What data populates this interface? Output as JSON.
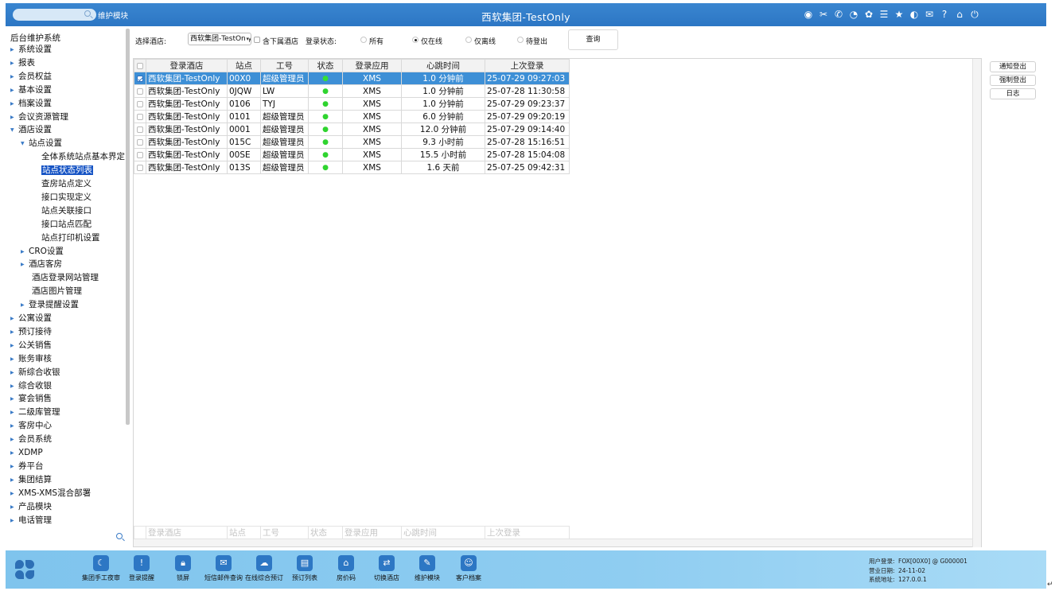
{
  "header": {
    "module_label": "维护模块",
    "title": "西软集团-TestOnly",
    "icons": [
      "wifi-icon",
      "tools-icon",
      "phone-icon",
      "help-circle-icon",
      "palette-icon",
      "menu-icon",
      "star-icon",
      "theme-icon",
      "mail-icon",
      "question-icon",
      "home-icon",
      "power-icon"
    ]
  },
  "sidebar": {
    "root": "后台维护系统",
    "nodes": [
      {
        "label": "系统设置",
        "level": 0,
        "arrow": "closed"
      },
      {
        "label": "报表",
        "level": 0,
        "arrow": "closed"
      },
      {
        "label": "会员权益",
        "level": 0,
        "arrow": "closed"
      },
      {
        "label": "基本设置",
        "level": 0,
        "arrow": "closed"
      },
      {
        "label": "档案设置",
        "level": 0,
        "arrow": "closed"
      },
      {
        "label": "会议资源管理",
        "level": 0,
        "arrow": "closed"
      },
      {
        "label": "酒店设置",
        "level": 0,
        "arrow": "open"
      },
      {
        "label": "站点设置",
        "level": 1,
        "arrow": "open"
      },
      {
        "label": "全体系统站点基本界定",
        "level": 2,
        "arrow": "none"
      },
      {
        "label": "站点状态列表",
        "level": 2,
        "arrow": "none",
        "selected": true
      },
      {
        "label": "查房站点定义",
        "level": 2,
        "arrow": "none"
      },
      {
        "label": "接口实现定义",
        "level": 2,
        "arrow": "none"
      },
      {
        "label": "站点关联接口",
        "level": 2,
        "arrow": "none"
      },
      {
        "label": "接口站点匹配",
        "level": 2,
        "arrow": "none"
      },
      {
        "label": "站点打印机设置",
        "level": 2,
        "arrow": "none"
      },
      {
        "label": "CRO设置",
        "level": 1,
        "arrow": "closed"
      },
      {
        "label": "酒店客房",
        "level": 1,
        "arrow": "closed"
      },
      {
        "label": "酒店登录网站管理",
        "level": 1,
        "arrow": "none"
      },
      {
        "label": "酒店图片管理",
        "level": 1,
        "arrow": "none"
      },
      {
        "label": "登录提醒设置",
        "level": 1,
        "arrow": "closed"
      },
      {
        "label": "公寓设置",
        "level": 0,
        "arrow": "closed"
      },
      {
        "label": "预订接待",
        "level": 0,
        "arrow": "closed"
      },
      {
        "label": "公关销售",
        "level": 0,
        "arrow": "closed"
      },
      {
        "label": "账务审核",
        "level": 0,
        "arrow": "closed"
      },
      {
        "label": "新综合收银",
        "level": 0,
        "arrow": "closed"
      },
      {
        "label": "综合收银",
        "level": 0,
        "arrow": "closed"
      },
      {
        "label": "宴会销售",
        "level": 0,
        "arrow": "closed"
      },
      {
        "label": "二级库管理",
        "level": 0,
        "arrow": "closed"
      },
      {
        "label": "客房中心",
        "level": 0,
        "arrow": "closed"
      },
      {
        "label": "会员系统",
        "level": 0,
        "arrow": "closed"
      },
      {
        "label": "XDMP",
        "level": 0,
        "arrow": "closed"
      },
      {
        "label": "券平台",
        "level": 0,
        "arrow": "closed"
      },
      {
        "label": "集团结算",
        "level": 0,
        "arrow": "closed"
      },
      {
        "label": "XMS-XMS混合部署",
        "level": 0,
        "arrow": "closed"
      },
      {
        "label": "产品模块",
        "level": 0,
        "arrow": "closed"
      },
      {
        "label": "电话管理",
        "level": 0,
        "arrow": "closed"
      }
    ]
  },
  "filter": {
    "hotel_label": "选择酒店:",
    "hotel_value": "西软集团-TestOnly",
    "include_sub_label": "含下属酒店",
    "status_label": "登录状态:",
    "radio_all": "所有",
    "radio_online": "仅在线",
    "radio_offline": "仅离线",
    "radio_pending": "待登出",
    "query_button": "查询"
  },
  "grid": {
    "columns": [
      "登录酒店",
      "站点",
      "工号",
      "状态",
      "登录应用",
      "心跳时间",
      "上次登录"
    ],
    "rows": [
      {
        "hotel": "西软集团-TestOnly",
        "site": "00X0",
        "emp": "超级管理员",
        "status": "●",
        "app": "XMS",
        "heartbeat": "1.0 分钟前",
        "last": "25-07-29 09:27:03",
        "checked": true
      },
      {
        "hotel": "西软集团-TestOnly",
        "site": "0JQW",
        "emp": "LW",
        "status": "●",
        "app": "XMS",
        "heartbeat": "1.0 分钟前",
        "last": "25-07-28 11:30:58",
        "checked": false
      },
      {
        "hotel": "西软集团-TestOnly",
        "site": "0106",
        "emp": "TYJ",
        "status": "●",
        "app": "XMS",
        "heartbeat": "1.0 分钟前",
        "last": "25-07-29 09:23:37",
        "checked": false
      },
      {
        "hotel": "西软集团-TestOnly",
        "site": "0101",
        "emp": "超级管理员",
        "status": "●",
        "app": "XMS",
        "heartbeat": "6.0 分钟前",
        "last": "25-07-29 09:20:19",
        "checked": false
      },
      {
        "hotel": "西软集团-TestOnly",
        "site": "0001",
        "emp": "超级管理员",
        "status": "●",
        "app": "XMS",
        "heartbeat": "12.0 分钟前",
        "last": "25-07-29 09:14:40",
        "checked": false
      },
      {
        "hotel": "西软集团-TestOnly",
        "site": "015C",
        "emp": "超级管理员",
        "status": "●",
        "app": "XMS",
        "heartbeat": "9.3 小时前",
        "last": "25-07-28 15:16:51",
        "checked": false
      },
      {
        "hotel": "西软集团-TestOnly",
        "site": "00SE",
        "emp": "超级管理员",
        "status": "●",
        "app": "XMS",
        "heartbeat": "15.5 小时前",
        "last": "25-07-28 15:04:08",
        "checked": false
      },
      {
        "hotel": "西软集团-TestOnly",
        "site": "013S",
        "emp": "超级管理员",
        "status": "●",
        "app": "XMS",
        "heartbeat": "1.6 天前",
        "last": "25-07-25 09:42:31",
        "checked": false
      }
    ],
    "status_color": "#2fd42f",
    "selected_color": "#3d8fd6"
  },
  "actions": {
    "notify_logout": "通知登出",
    "force_logout": "强制登出",
    "log": "日志"
  },
  "dock": {
    "items": [
      {
        "label": "集团手工夜审",
        "icon": "moon-icon",
        "glyph": "☾"
      },
      {
        "label": "登录提醒",
        "icon": "alert-icon",
        "glyph": "!"
      },
      {
        "label": "锁屏",
        "icon": "lock-icon",
        "glyph": "🔒︎"
      },
      {
        "label": "短信邮件查询",
        "icon": "mail-icon",
        "glyph": "✉"
      },
      {
        "label": "在线综合预订",
        "icon": "cloud-icon",
        "glyph": "☁"
      },
      {
        "label": "预订列表",
        "icon": "list-icon",
        "glyph": "▤"
      },
      {
        "label": "房价码",
        "icon": "home-icon",
        "glyph": "⌂"
      },
      {
        "label": "切换酒店",
        "icon": "switch-icon",
        "glyph": "⇄"
      },
      {
        "label": "维护模块",
        "icon": "wrench-icon",
        "glyph": "✎"
      },
      {
        "label": "客户档案",
        "icon": "profile-icon",
        "glyph": "☺"
      }
    ]
  },
  "user_info": {
    "user_label": "用户登录:",
    "user_value": "FOX[00X0] @ G000001",
    "date_label": "营业日期:",
    "date_value": "24-11-02",
    "addr_label": "系统地址:",
    "addr_value": "127.0.0.1"
  }
}
